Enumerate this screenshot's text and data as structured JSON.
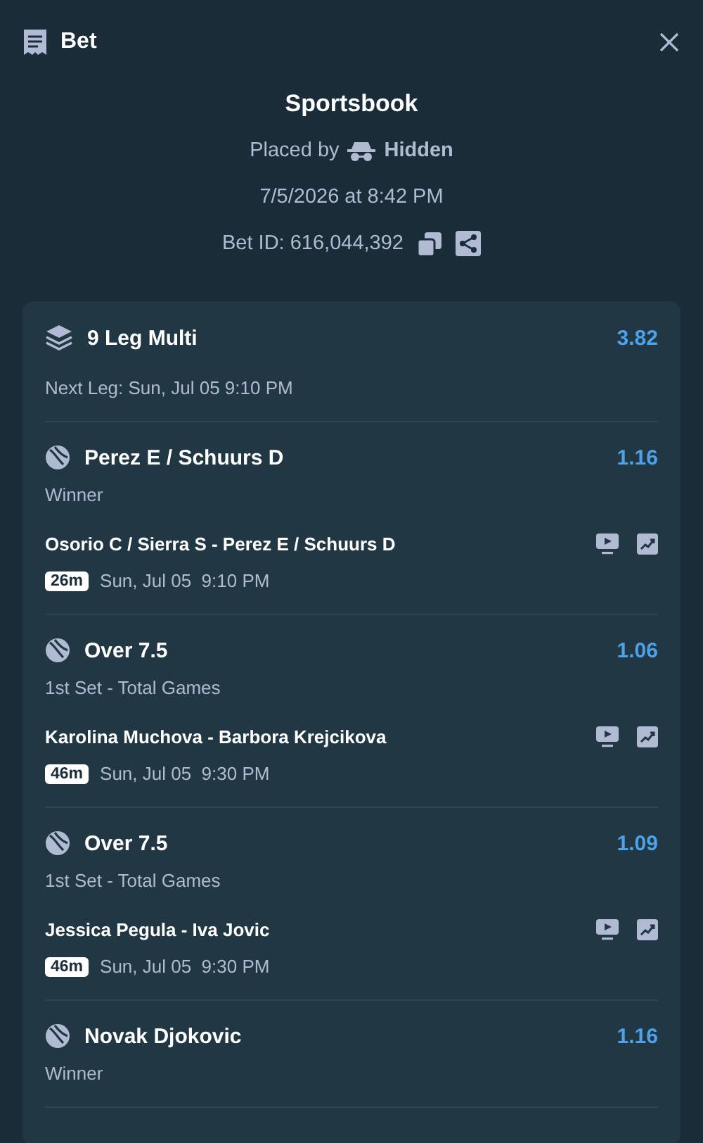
{
  "header": {
    "title": "Bet"
  },
  "summary": {
    "title": "Sportsbook",
    "placed_by_label": "Placed by",
    "placed_by_name": "Hidden",
    "placed_at": "7/5/2026 at 8:42 PM",
    "bet_id": "Bet ID: 616,044,392"
  },
  "multi": {
    "title": "9 Leg Multi",
    "odds": "3.82",
    "next_leg": "Next Leg: Sun, Jul 05 9:10 PM"
  },
  "legs": [
    {
      "title": "Perez E / Schuurs D",
      "odds": "1.16",
      "market": "Winner",
      "match": "Osorio C / Sierra S - Perez E / Schuurs D",
      "countdown": "26m",
      "time": "Sun, Jul 05  9:10 PM"
    },
    {
      "title": "Over 7.5",
      "odds": "1.06",
      "market": "1st Set - Total Games",
      "match": "Karolina Muchova - Barbora Krejcikova",
      "countdown": "46m",
      "time": "Sun, Jul 05  9:30 PM"
    },
    {
      "title": "Over 7.5",
      "odds": "1.09",
      "market": "1st Set - Total Games",
      "match": "Jessica Pegula - Iva Jovic",
      "countdown": "46m",
      "time": "Sun, Jul 05  9:30 PM"
    },
    {
      "title": "Novak Djokovic",
      "odds": "1.16",
      "market": "Winner"
    }
  ]
}
